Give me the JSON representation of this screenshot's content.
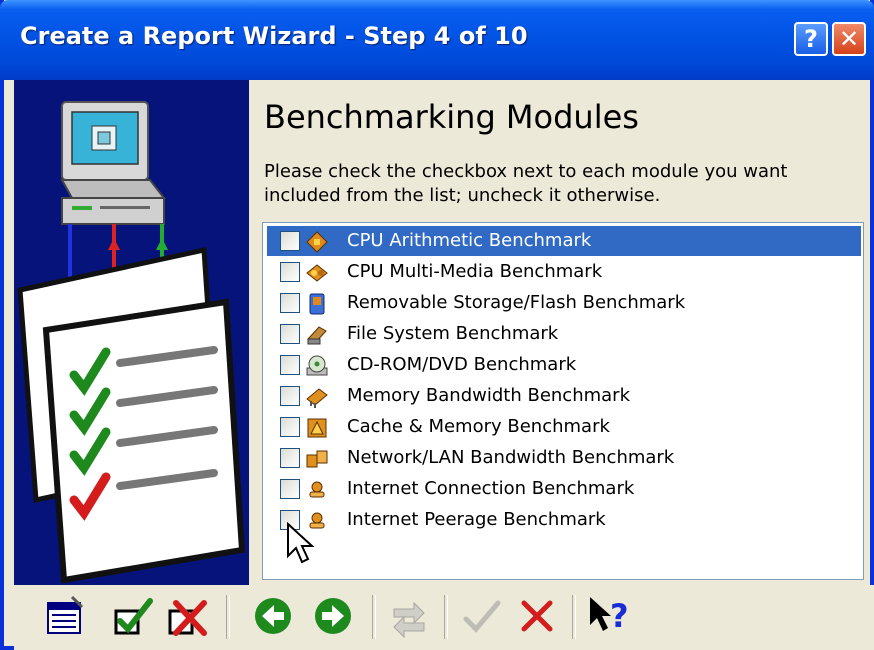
{
  "window": {
    "title": "Create a Report Wizard - Step 4 of 10",
    "help_glyph": "?",
    "close_glyph": "✕"
  },
  "page": {
    "heading": "Benchmarking Modules",
    "description": "Please check the checkbox next to each module you want included from the list; uncheck it otherwise."
  },
  "modules": [
    {
      "label": "CPU Arithmetic Benchmark",
      "checked": false,
      "selected": true,
      "icon": "cpu-arithmetic-icon"
    },
    {
      "label": "CPU Multi-Media Benchmark",
      "checked": false,
      "selected": false,
      "icon": "cpu-multimedia-icon"
    },
    {
      "label": "Removable Storage/Flash Benchmark",
      "checked": false,
      "selected": false,
      "icon": "removable-storage-icon"
    },
    {
      "label": "File System Benchmark",
      "checked": false,
      "selected": false,
      "icon": "file-system-icon"
    },
    {
      "label": "CD-ROM/DVD Benchmark",
      "checked": false,
      "selected": false,
      "icon": "cdrom-icon"
    },
    {
      "label": "Memory Bandwidth Benchmark",
      "checked": false,
      "selected": false,
      "icon": "memory-icon"
    },
    {
      "label": "Cache & Memory Benchmark",
      "checked": false,
      "selected": false,
      "icon": "cache-icon"
    },
    {
      "label": "Network/LAN Bandwidth Benchmark",
      "checked": false,
      "selected": false,
      "icon": "network-icon"
    },
    {
      "label": "Internet Connection Benchmark",
      "checked": false,
      "selected": false,
      "icon": "internet-icon"
    },
    {
      "label": "Internet Peerage Benchmark",
      "checked": false,
      "selected": false,
      "icon": "internet-peerage-icon"
    }
  ],
  "toolbar": {
    "buttons": [
      "report-icon",
      "check-all-icon",
      "uncheck-all-icon",
      "back-icon",
      "next-icon",
      "refresh-icon",
      "ok-icon",
      "cancel-icon",
      "context-help-icon"
    ]
  },
  "colors": {
    "title_bar": "#0255e6",
    "selection": "#316ac5",
    "left_panel": "#06137a",
    "check_green": "#1e8a1e",
    "check_red": "#d41c1c"
  }
}
